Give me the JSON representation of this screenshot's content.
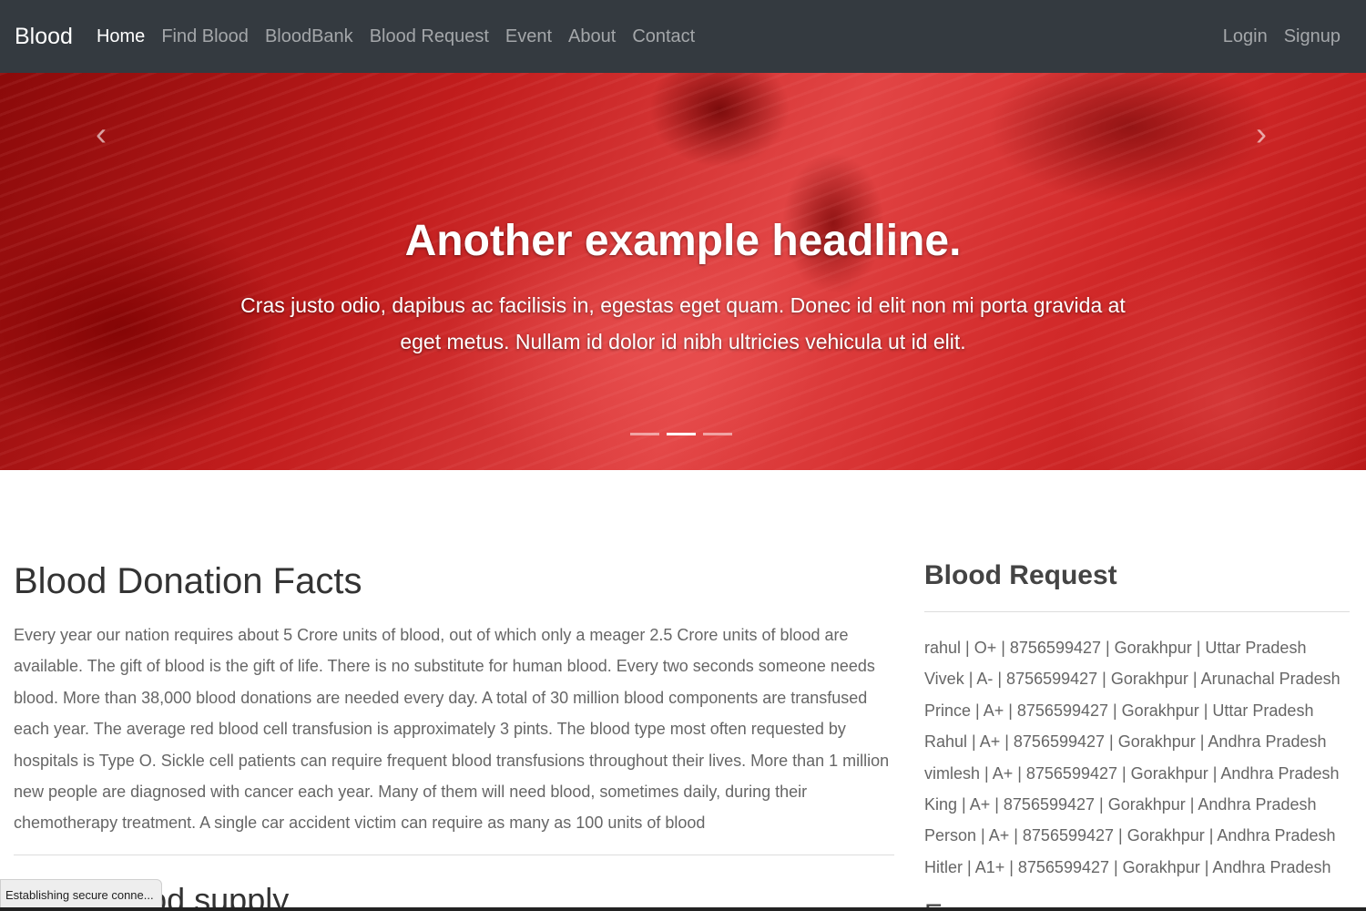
{
  "navbar": {
    "brand": "Blood",
    "links": [
      {
        "label": "Home"
      },
      {
        "label": "Find Blood"
      },
      {
        "label": "BloodBank"
      },
      {
        "label": "Blood Request"
      },
      {
        "label": "Event"
      },
      {
        "label": "About"
      },
      {
        "label": "Contact"
      }
    ],
    "login": "Login",
    "signup": "Signup"
  },
  "hero": {
    "prev_icon": "chevron-left-icon",
    "next_icon": "chevron-right-icon",
    "title": "Another example headline.",
    "text": "Cras justo odio, dapibus ac facilisis in, egestas eget quam. Donec id elit non mi porta gravida at eget metus. Nullam id dolor id nibh ultricies vehicula ut id elit.",
    "slide_count": 3,
    "active_slide": 2
  },
  "facts": {
    "title": "Blood Donation Facts",
    "text": "Every year our nation requires about 5 Crore units of blood, out of which only a meager 2.5 Crore units of blood are available. The gift of blood is the gift of life. There is no substitute for human blood. Every two seconds someone needs blood. More than 38,000 blood donations are needed every day. A total of 30 million blood components are transfused each year. The average red blood cell transfusion is approximately 3 pints. The blood type most often requested by hospitals is Type O. Sickle cell patients can require frequent blood transfusions throughout their lives. More than 1 million new people are diagnosed with cancer each year. Many of them will need blood, sometimes daily, during their chemotherapy treatment. A single car accident victim can require as many as 100 units of blood",
    "subtitle_partial": "ut the blood supply"
  },
  "sidebar": {
    "title": "Blood Request",
    "text": "rahul | O+ | 8756599427 | Gorakhpur | Uttar Pradesh Vivek | A- | 8756599427 | Gorakhpur | Arunachal Pradesh Prince | A+ | 8756599427 | Gorakhpur | Uttar Pradesh Rahul | A+ | 8756599427 | Gorakhpur | Andhra Pradesh vimlesh | A+ | 8756599427 | Gorakhpur | Andhra Pradesh King | A+ | 8756599427 | Gorakhpur | Andhra Pradesh Person | A+ | 8756599427 | Gorakhpur | Andhra Pradesh Hitler | A1+ | 8756599427 | Gorakhpur | Andhra Pradesh",
    "next_title_partial": "E"
  },
  "status_bar": {
    "text": "Establishing secure conne..."
  }
}
